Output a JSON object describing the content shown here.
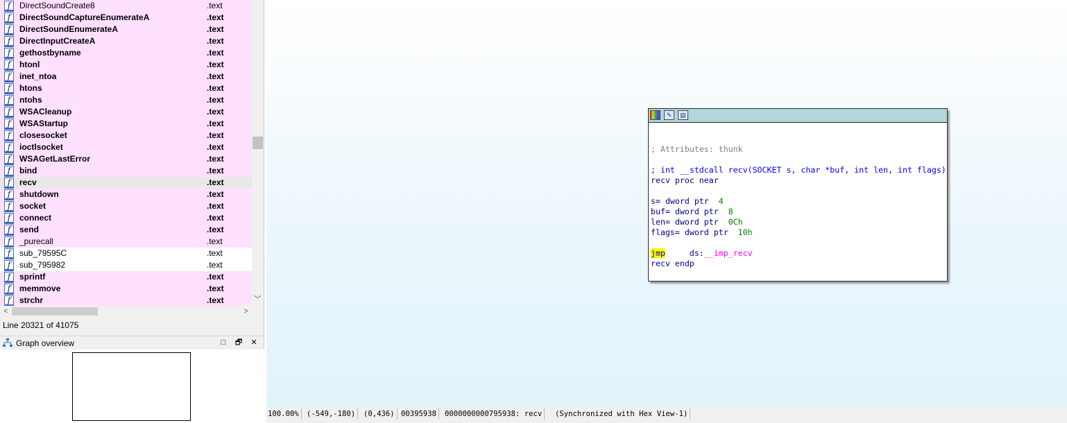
{
  "functions": {
    "rows": [
      {
        "name": "DirectSoundCreate8",
        "segment": ".text",
        "bold": false,
        "style": "pink"
      },
      {
        "name": "DirectSoundCaptureEnumerateA",
        "segment": ".text",
        "bold": true,
        "style": "pink"
      },
      {
        "name": "DirectSoundEnumerateA",
        "segment": ".text",
        "bold": true,
        "style": "pink"
      },
      {
        "name": "DirectInputCreateA",
        "segment": ".text",
        "bold": true,
        "style": "pink"
      },
      {
        "name": "gethostbyname",
        "segment": ".text",
        "bold": true,
        "style": "pink"
      },
      {
        "name": "htonl",
        "segment": ".text",
        "bold": true,
        "style": "pink"
      },
      {
        "name": "inet_ntoa",
        "segment": ".text",
        "bold": true,
        "style": "pink"
      },
      {
        "name": "htons",
        "segment": ".text",
        "bold": true,
        "style": "pink"
      },
      {
        "name": "ntohs",
        "segment": ".text",
        "bold": true,
        "style": "pink"
      },
      {
        "name": "WSACleanup",
        "segment": ".text",
        "bold": true,
        "style": "pink"
      },
      {
        "name": "WSAStartup",
        "segment": ".text",
        "bold": true,
        "style": "pink"
      },
      {
        "name": "closesocket",
        "segment": ".text",
        "bold": true,
        "style": "pink"
      },
      {
        "name": "ioctlsocket",
        "segment": ".text",
        "bold": true,
        "style": "pink"
      },
      {
        "name": "WSAGetLastError",
        "segment": ".text",
        "bold": true,
        "style": "pink"
      },
      {
        "name": "bind",
        "segment": ".text",
        "bold": true,
        "style": "pink"
      },
      {
        "name": "recv",
        "segment": ".text",
        "bold": true,
        "style": "selected"
      },
      {
        "name": "shutdown",
        "segment": ".text",
        "bold": true,
        "style": "pink"
      },
      {
        "name": "socket",
        "segment": ".text",
        "bold": true,
        "style": "pink"
      },
      {
        "name": "connect",
        "segment": ".text",
        "bold": true,
        "style": "pink"
      },
      {
        "name": "send",
        "segment": ".text",
        "bold": true,
        "style": "pink"
      },
      {
        "name": "_purecall",
        "segment": ".text",
        "bold": false,
        "style": "pink"
      },
      {
        "name": "sub_79595C",
        "segment": ".text",
        "bold": false,
        "style": "plain"
      },
      {
        "name": "sub_795982",
        "segment": ".text",
        "bold": false,
        "style": "plain"
      },
      {
        "name": "sprintf",
        "segment": ".text",
        "bold": true,
        "style": "pink"
      },
      {
        "name": "memmove",
        "segment": ".text",
        "bold": true,
        "style": "pink"
      },
      {
        "name": "strchr",
        "segment": ".text",
        "bold": true,
        "style": "pink"
      }
    ],
    "icon_glyph": "f",
    "row_icon": "function-icon"
  },
  "line_status": "Line 20321 of 41075",
  "graph_overview": {
    "title": "Graph overview",
    "buttons": {
      "maximize": "□",
      "restore": "🗗",
      "close": "✕"
    }
  },
  "node": {
    "toolbar_icons": [
      "color-palette-icon",
      "edit-icon",
      "grid-icon"
    ],
    "code": {
      "attributes": "; Attributes: thunk",
      "prototype": "; int __stdcall recv(SOCKET s, char *buf, int len, int flags)",
      "proc_start": "recv proc near",
      "args": [
        {
          "name": "s",
          "rest": "= dword ptr  ",
          "value": "4"
        },
        {
          "name": "buf",
          "rest": "= dword ptr  ",
          "value": "8"
        },
        {
          "name": "len",
          "rest": "= dword ptr  ",
          "value": "0Ch"
        },
        {
          "name": "flags",
          "rest": "= dword ptr  ",
          "value": "10h"
        }
      ],
      "instr_mnemonic": "jmp",
      "instr_operand_prefix": "ds:",
      "instr_operand": "__imp_recv",
      "proc_end": "recv endp"
    }
  },
  "statusbar": {
    "zoom": "100.00%",
    "mouse_coords": "(-549,-180)",
    "graph_coords": "(0,436)",
    "file_offset": "00395938",
    "address_label": "0000000000795938: recv",
    "sync": "(Synchronized with Hex View-1)"
  },
  "colors": {
    "row_pink": "#ffe0ff",
    "row_selected": "#e8e8e8",
    "node_title": "#b1d6dc",
    "highlight": "#ffff00"
  }
}
